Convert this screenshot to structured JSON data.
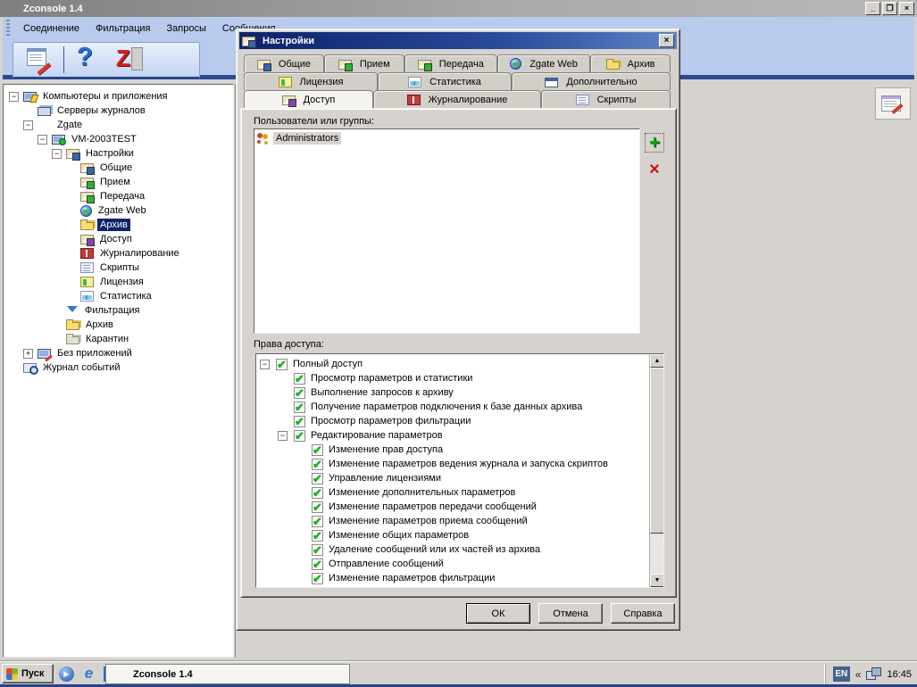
{
  "colors": {
    "selection": "#0a246a",
    "dialog_title_gradient_start": "#0c226b",
    "check_green": "#1db31d",
    "delete_red": "#cc1111",
    "menu_band_blue": "#b9cbec",
    "accent_navy_strip": "#2c4a91"
  },
  "window": {
    "title": "Zconsole 1.4",
    "controls": {
      "minimize": "_",
      "restore": "❐",
      "close": "×"
    },
    "menu": [
      "Соединение",
      "Фильтрация",
      "Запросы",
      "Сообщения"
    ],
    "toolbar_icons": [
      "edit-console-icon",
      "help-icon",
      "zgate-icon"
    ]
  },
  "tree": {
    "items": [
      {
        "label": "Компьютеры и приложения",
        "level": 0,
        "icon": "monitor-flash",
        "exp": "minus"
      },
      {
        "label": "Серверы журналов",
        "level": 1,
        "icon": "servers"
      },
      {
        "label": "Zgate",
        "level": 1,
        "icon": "zgate",
        "exp": "minus"
      },
      {
        "label": "VM-2003TEST",
        "level": 2,
        "icon": "server-green",
        "exp": "minus"
      },
      {
        "label": "Настройки",
        "level": 3,
        "icon": "env-tools",
        "exp": "minus"
      },
      {
        "label": "Общие",
        "level": 4,
        "icon": "env-tools"
      },
      {
        "label": "Прием",
        "level": 4,
        "icon": "env-down"
      },
      {
        "label": "Передача",
        "level": 4,
        "icon": "env-up"
      },
      {
        "label": "Zgate Web",
        "level": 4,
        "icon": "globe"
      },
      {
        "label": "Архив",
        "level": 4,
        "icon": "folders",
        "selected": true
      },
      {
        "label": "Доступ",
        "level": 4,
        "icon": "env-person"
      },
      {
        "label": "Журналирование",
        "level": 4,
        "icon": "book"
      },
      {
        "label": "Скрипты",
        "level": 4,
        "icon": "scroll"
      },
      {
        "label": "Лицензия",
        "level": 4,
        "icon": "card"
      },
      {
        "label": "Статистика",
        "level": 4,
        "icon": "chart"
      },
      {
        "label": "Фильтрация",
        "level": 3,
        "icon": "funnel"
      },
      {
        "label": "Архив",
        "level": 3,
        "icon": "folders"
      },
      {
        "label": "Карантин",
        "level": 3,
        "icon": "folders-gray"
      },
      {
        "label": "Без приложений",
        "level": 1,
        "icon": "monitor-edit",
        "exp": "plus"
      },
      {
        "label": "Журнал событий",
        "level": 0,
        "icon": "journal-mag"
      }
    ]
  },
  "right_pane": {
    "toolbar_icon": "table-pencil-icon"
  },
  "dialog": {
    "title": "Настройки",
    "close": "×",
    "tab_rows": [
      [
        {
          "label": "Общие",
          "icon": "env-tools"
        },
        {
          "label": "Прием",
          "icon": "env-down"
        },
        {
          "label": "Передача",
          "icon": "env-up"
        },
        {
          "label": "Zgate Web",
          "icon": "globe"
        },
        {
          "label": "Архив",
          "icon": "folders"
        }
      ],
      [
        {
          "label": "Лицензия",
          "icon": "card"
        },
        {
          "label": "Статистика",
          "icon": "chart"
        },
        {
          "label": "Дополнительно",
          "icon": "window"
        }
      ],
      [
        {
          "label": "Доступ",
          "icon": "env-person",
          "active": true
        },
        {
          "label": "Журналирование",
          "icon": "book"
        },
        {
          "label": "Скрипты",
          "icon": "scroll"
        }
      ]
    ],
    "users_label": "Пользователи или группы:",
    "users": [
      {
        "label": "Administrators",
        "icon": "people"
      }
    ],
    "add_button": "+",
    "delete_button": "×",
    "rights_label": "Права доступа:",
    "rights": [
      {
        "label": "Полный доступ",
        "level": 0,
        "exp": "minus",
        "checked": true
      },
      {
        "label": "Просмотр параметров и статистики",
        "level": 1,
        "checked": true
      },
      {
        "label": "Выполнение запросов к архиву",
        "level": 1,
        "checked": true
      },
      {
        "label": "Получение параметров подключения к базе данных архива",
        "level": 1,
        "checked": true
      },
      {
        "label": "Просмотр параметров фильтрации",
        "level": 1,
        "checked": true
      },
      {
        "label": "Редактирование параметров",
        "level": 1,
        "exp": "minus",
        "checked": true
      },
      {
        "label": "Изменение прав доступа",
        "level": 2,
        "checked": true
      },
      {
        "label": "Изменение параметров ведения журнала и запуска скриптов",
        "level": 2,
        "checked": true
      },
      {
        "label": "Управление лицензиями",
        "level": 2,
        "checked": true
      },
      {
        "label": "Изменение дополнительных параметров",
        "level": 2,
        "checked": true
      },
      {
        "label": "Изменение параметров передачи сообщений",
        "level": 2,
        "checked": true
      },
      {
        "label": "Изменение параметров приема сообщений",
        "level": 2,
        "checked": true
      },
      {
        "label": "Изменение общих параметров",
        "level": 2,
        "checked": true
      },
      {
        "label": "Удаление сообщений или их частей из архива",
        "level": 2,
        "checked": true
      },
      {
        "label": "Отправление сообщений",
        "level": 2,
        "checked": true
      },
      {
        "label": "Изменение параметров фильтрации",
        "level": 2,
        "checked": true
      }
    ],
    "buttons": [
      {
        "label": "ОК",
        "default": true
      },
      {
        "label": "Отмена"
      },
      {
        "label": "Справка"
      }
    ]
  },
  "taskbar": {
    "start_label": "Пуск",
    "quick_launch": [
      "media-player-icon",
      "internet-explorer-icon",
      "window-icon"
    ],
    "task_button": {
      "label": "Zconsole 1.4",
      "icon": "zgate-icon"
    },
    "tray": {
      "lang": "EN",
      "chevron": "«",
      "icons": [
        "network-icon"
      ],
      "time": "16:45"
    }
  }
}
